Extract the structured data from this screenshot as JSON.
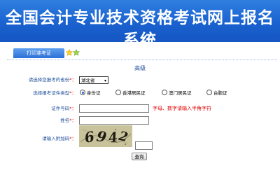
{
  "header": {
    "title": "全国会计专业技术资格考试网上报名系统"
  },
  "tabs": {
    "print_admission_label": "打印准考证"
  },
  "form": {
    "title": "高级",
    "province_label": "请选择您报考的省份",
    "province_value": "湖北省",
    "id_type_label": "选择报考证件类型",
    "id_type_options": [
      "身份证",
      "香港居民证",
      "澳门居民证",
      "台胞证"
    ],
    "id_type_selected": "身份证",
    "id_number_label": "证件号码",
    "id_number_value": "",
    "id_number_hint": "字母、数字请输入半角字符",
    "name_label": "姓名",
    "name_value": "",
    "captcha_label": "请输入附加码",
    "captcha_text": "6942",
    "captcha_value": "",
    "required_mark": "*：",
    "query_button_label": "查询"
  },
  "colors": {
    "banner": "#1a62d0",
    "label_text": "#1d4f9c",
    "required": "#e00000",
    "hint": "#e00000"
  },
  "icons": [
    "star-icon",
    "chevron-down-icon"
  ]
}
